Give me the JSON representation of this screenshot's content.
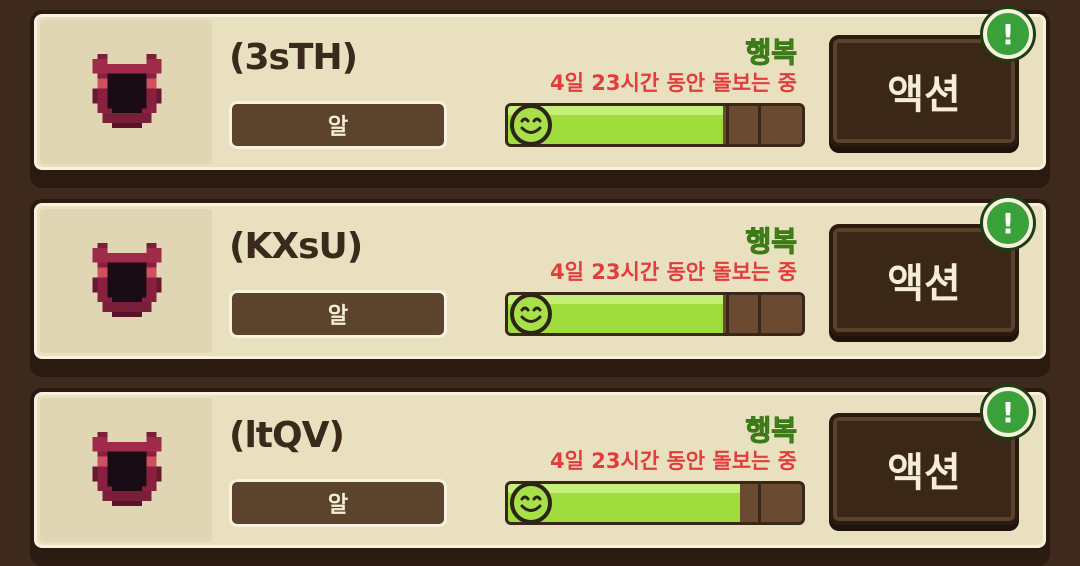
{
  "pets": [
    {
      "name": "(3sTH)",
      "stage": "알",
      "mood": "행복",
      "care_status": "4일 23시간 동안 돌보는 중",
      "happiness_fill": 0.73,
      "action_label": "액션",
      "alert_glyph": "!",
      "portrait_icon": "horned-demon-egg-icon"
    },
    {
      "name": "(KXsU)",
      "stage": "알",
      "mood": "행복",
      "care_status": "4일 23시간 동안 돌보는 중",
      "happiness_fill": 0.73,
      "action_label": "액션",
      "alert_glyph": "!",
      "portrait_icon": "horned-demon-egg-icon"
    },
    {
      "name": "(ltQV)",
      "stage": "알",
      "mood": "행복",
      "care_status": "4일 23시간 동안 돌보는 중",
      "happiness_fill": 0.79,
      "action_label": "액션",
      "alert_glyph": "!",
      "portrait_icon": "horned-demon-egg-icon"
    }
  ],
  "colors": {
    "mood_text": "#5aa02c",
    "care_text": "#e23d3d",
    "bar_fill": "#9fdc3c",
    "alert_badge": "#3aa13a"
  }
}
